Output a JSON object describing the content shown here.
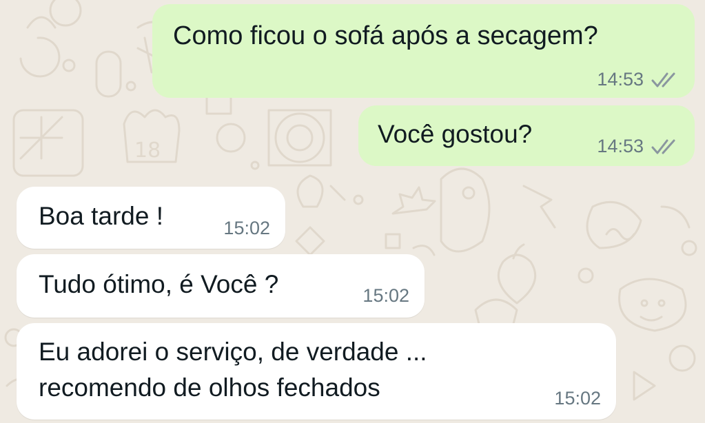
{
  "messages": [
    {
      "direction": "outgoing",
      "text": "Como ficou o sofá após a secagem?",
      "time": "14:53",
      "status_icon": "double-check-icon"
    },
    {
      "direction": "outgoing",
      "text": "Você gostou?",
      "time": "14:53",
      "status_icon": "double-check-icon"
    },
    {
      "direction": "incoming",
      "text": "Boa tarde !",
      "time": "15:02"
    },
    {
      "direction": "incoming",
      "text": "Tudo ótimo, é Você ?",
      "time": "15:02"
    },
    {
      "direction": "incoming",
      "lines": [
        "Eu adorei o serviço, de verdade  ...",
        "recomendo de olhos fechados"
      ],
      "time": "15:02"
    }
  ],
  "colors": {
    "outgoing_bubble": "#dcf8c6",
    "incoming_bubble": "#ffffff",
    "chat_background": "#efeae2",
    "timestamp": "#667781",
    "read_ticks": "#8a969f"
  }
}
